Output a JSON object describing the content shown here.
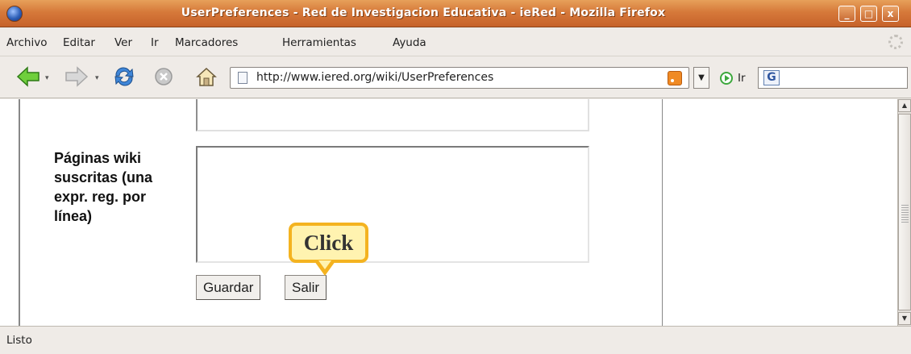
{
  "window": {
    "title": "UserPreferences - Red de Investigacion Educativa - ieRed - Mozilla Firefox",
    "minimize_label": "_",
    "maximize_label": "□",
    "close_label": "x"
  },
  "menu": {
    "items": [
      "Archivo",
      "Editar",
      "Ver",
      "Ir",
      "Marcadores",
      "Herramientas",
      "Ayuda"
    ]
  },
  "toolbar": {
    "url": "http://www.iered.org/wiki/UserPreferences",
    "go_label": "Ir",
    "search_engine_letter": "G"
  },
  "form": {
    "subscribed_label": "Páginas wiki suscritas (una expr. reg. por línea)",
    "save_button": "Guardar",
    "exit_button": "Salir"
  },
  "annotation": {
    "callout_text": "Click"
  },
  "status": {
    "text": "Listo"
  },
  "colors": {
    "titlebar": "#d6793a",
    "callout_border": "#f4b320",
    "callout_fill": "#fff3b0"
  }
}
